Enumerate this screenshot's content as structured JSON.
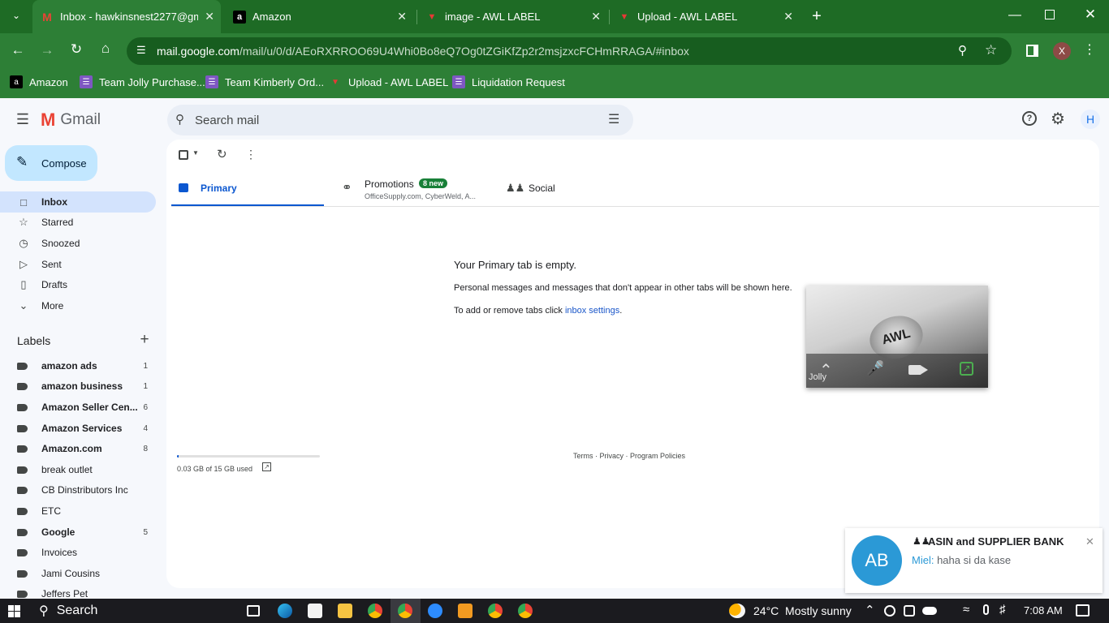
{
  "browser": {
    "tabs": [
      {
        "title": "Inbox - hawkinsnest2277@gma",
        "favicon": "gmail-icon",
        "active": true
      },
      {
        "title": "Amazon",
        "favicon": "amazon-icon",
        "active": false
      },
      {
        "title": "image - AWL LABEL",
        "favicon": "awl-icon",
        "active": false
      },
      {
        "title": "Upload - AWL LABEL",
        "favicon": "awl-icon",
        "active": false
      }
    ],
    "url_host": "mail.google.com",
    "url_path": "/mail/u/0/d/AEoRXRROO69U4Whi0Bo8eQ7Og0tZGiKfZp2r2msjzxcFCHmRRAGA/#inbox",
    "profile_initial": "X",
    "bookmarks": [
      {
        "label": "Amazon",
        "icon": "amazon-icon"
      },
      {
        "label": "Team Jolly Purchase...",
        "icon": "sheet-icon"
      },
      {
        "label": "Team Kimberly Ord...",
        "icon": "sheet-icon"
      },
      {
        "label": "Upload - AWL LABEL",
        "icon": "awl-icon"
      },
      {
        "label": "Liquidation Request",
        "icon": "sheet-icon"
      }
    ]
  },
  "gmail": {
    "logo": "Gmail",
    "search_placeholder": "Search mail",
    "compose": "Compose",
    "avatar_initial": "H",
    "nav": [
      {
        "label": "Inbox",
        "icon": "inbox-icon"
      },
      {
        "label": "Starred",
        "icon": "star-icon"
      },
      {
        "label": "Snoozed",
        "icon": "clock-icon"
      },
      {
        "label": "Sent",
        "icon": "send-icon"
      },
      {
        "label": "Drafts",
        "icon": "draft-icon"
      },
      {
        "label": "More",
        "icon": "chevron-down-icon"
      }
    ],
    "labels_heading": "Labels",
    "labels": [
      {
        "name": "amazon ads",
        "count": "1",
        "bold": true
      },
      {
        "name": "amazon business",
        "count": "1",
        "bold": true
      },
      {
        "name": "Amazon Seller Cen...",
        "count": "6",
        "bold": true
      },
      {
        "name": "Amazon Services",
        "count": "4",
        "bold": true
      },
      {
        "name": "Amazon.com",
        "count": "8",
        "bold": true
      },
      {
        "name": "break outlet",
        "count": "",
        "bold": false
      },
      {
        "name": "CB Dinstributors Inc",
        "count": "",
        "bold": false
      },
      {
        "name": "ETC",
        "count": "",
        "bold": false
      },
      {
        "name": "Google",
        "count": "5",
        "bold": true
      },
      {
        "name": "Invoices",
        "count": "",
        "bold": false
      },
      {
        "name": "Jami Cousins",
        "count": "",
        "bold": false
      },
      {
        "name": "Jeffers Pet",
        "count": "",
        "bold": false
      }
    ],
    "category_tabs": {
      "primary": "Primary",
      "promotions": "Promotions",
      "promotions_badge": "8 new",
      "promotions_snippet": "OfficeSupply.com, CyberWeld, A...",
      "social": "Social"
    },
    "empty": {
      "title": "Your Primary tab is empty.",
      "line1": "Personal messages and messages that don't appear in other tabs will be shown here.",
      "line2_prefix": "To add or remove tabs click ",
      "line2_link": "inbox settings",
      "line2_suffix": "."
    },
    "storage": {
      "text": "0.03 GB of 15 GB used",
      "fraction": 0.002
    },
    "footer": {
      "terms": "Terms",
      "privacy": "Privacy",
      "policies": "Program Policies",
      "sep": " · "
    }
  },
  "pip": {
    "caller": "Jolly"
  },
  "notification": {
    "avatar": "AB",
    "group": "ASIN and SUPPLIER BANK",
    "sender": "Miel:",
    "message": "haha si da kase"
  },
  "taskbar": {
    "search": "Search",
    "weather": "24°C  Mostly sunny",
    "time": "7:08 AM"
  }
}
